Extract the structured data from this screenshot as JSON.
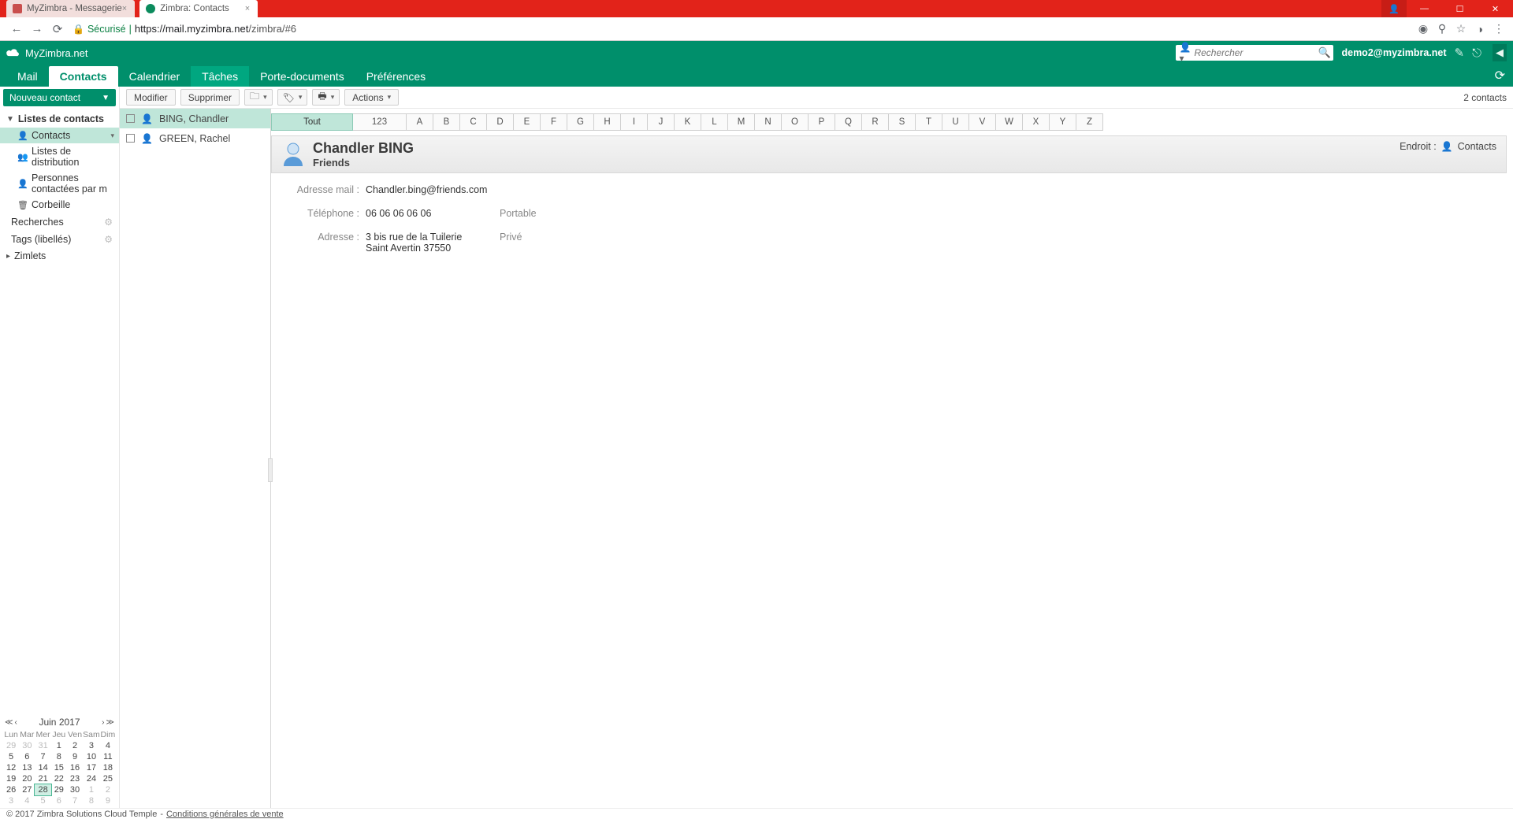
{
  "browser": {
    "tabs": [
      {
        "title": "MyZimbra - Messagerie"
      },
      {
        "title": "Zimbra: Contacts"
      }
    ],
    "secure_label": "Sécurisé",
    "url_host": "https://mail.myzimbra.net",
    "url_path": "/zimbra/#6"
  },
  "header": {
    "logo_text": "MyZimbra.net",
    "search_placeholder": "Rechercher",
    "user_email": "demo2@myzimbra.net"
  },
  "tabs": {
    "mail": "Mail",
    "contacts": "Contacts",
    "calendar": "Calendrier",
    "tasks": "Tâches",
    "briefcase": "Porte-documents",
    "preferences": "Préférences"
  },
  "toolbar": {
    "new_contact": "Nouveau contact",
    "edit": "Modifier",
    "delete": "Supprimer",
    "actions": "Actions",
    "count": "2 contacts"
  },
  "sidebar": {
    "lists_header": "Listes de contacts",
    "items": {
      "contacts": "Contacts",
      "distribution": "Listes de distribution",
      "emailed": "Personnes contactées par m",
      "trash": "Corbeille"
    },
    "searches": "Recherches",
    "tags": "Tags (libellés)",
    "zimlets": "Zimlets"
  },
  "contact_list": [
    {
      "display": "BING, Chandler",
      "selected": true
    },
    {
      "display": "GREEN, Rachel",
      "selected": false
    }
  ],
  "alpha": {
    "all": "Tout",
    "digits": "123",
    "letters": [
      "A",
      "B",
      "C",
      "D",
      "E",
      "F",
      "G",
      "H",
      "I",
      "J",
      "K",
      "L",
      "M",
      "N",
      "O",
      "P",
      "Q",
      "R",
      "S",
      "T",
      "U",
      "V",
      "W",
      "X",
      "Y",
      "Z"
    ]
  },
  "card": {
    "name": "Chandler BING",
    "org": "Friends",
    "location_label": "Endroit :",
    "location_value": "Contacts",
    "fields": {
      "email_label": "Adresse mail :",
      "email_value": "Chandler.bing@friends.com",
      "phone_label": "Téléphone :",
      "phone_value": "06 06 06 06 06",
      "phone_type": "Portable",
      "address_label": "Adresse :",
      "address_line1": "3 bis rue de la Tuilerie",
      "address_line2": "Saint Avertin 37550",
      "address_type": "Privé"
    }
  },
  "calendar": {
    "title": "Juin 2017",
    "dow": [
      "Lun",
      "Mar",
      "Mer",
      "Jeu",
      "Ven",
      "Sam",
      "Dim"
    ],
    "weeks": [
      [
        {
          "d": "29",
          "o": true
        },
        {
          "d": "30",
          "o": true
        },
        {
          "d": "31",
          "o": true
        },
        {
          "d": "1"
        },
        {
          "d": "2"
        },
        {
          "d": "3"
        },
        {
          "d": "4"
        }
      ],
      [
        {
          "d": "5"
        },
        {
          "d": "6"
        },
        {
          "d": "7"
        },
        {
          "d": "8"
        },
        {
          "d": "9"
        },
        {
          "d": "10"
        },
        {
          "d": "11"
        }
      ],
      [
        {
          "d": "12"
        },
        {
          "d": "13"
        },
        {
          "d": "14"
        },
        {
          "d": "15"
        },
        {
          "d": "16"
        },
        {
          "d": "17"
        },
        {
          "d": "18"
        }
      ],
      [
        {
          "d": "19"
        },
        {
          "d": "20"
        },
        {
          "d": "21"
        },
        {
          "d": "22"
        },
        {
          "d": "23"
        },
        {
          "d": "24"
        },
        {
          "d": "25"
        }
      ],
      [
        {
          "d": "26"
        },
        {
          "d": "27"
        },
        {
          "d": "28",
          "t": true
        },
        {
          "d": "29"
        },
        {
          "d": "30"
        },
        {
          "d": "1",
          "o": true
        },
        {
          "d": "2",
          "o": true
        }
      ],
      [
        {
          "d": "3",
          "o": true
        },
        {
          "d": "4",
          "o": true
        },
        {
          "d": "5",
          "o": true
        },
        {
          "d": "6",
          "o": true
        },
        {
          "d": "7",
          "o": true
        },
        {
          "d": "8",
          "o": true
        },
        {
          "d": "9",
          "o": true
        }
      ]
    ]
  },
  "footer": {
    "copyright": "© 2017 Zimbra Solutions Cloud Temple",
    "separator": "-",
    "terms": "Conditions générales de vente"
  }
}
